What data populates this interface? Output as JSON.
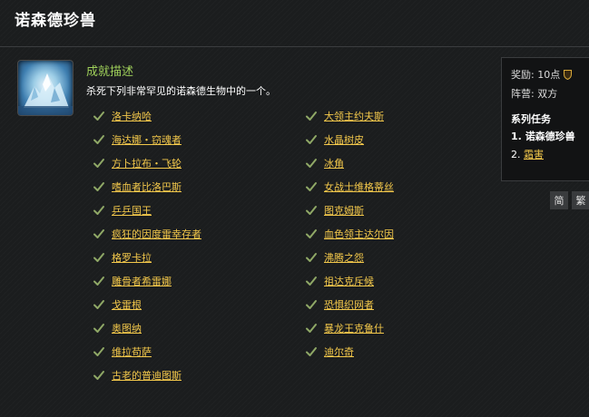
{
  "page": {
    "title": "诺森德珍兽"
  },
  "achievement": {
    "icon": "frozen-mountain-icon",
    "description_heading": "成就描述",
    "description": "杀死下列非常罕见的诺森德生物中的一个。"
  },
  "criteria": {
    "left": [
      "洛卡纳哈",
      "海达娜・窃魂者",
      "方卜拉布・飞轮",
      "嗜血者比洛巴斯",
      "乒乒国王",
      "疯狂的因度雷幸存者",
      "格罗卡拉",
      "雕骨者希雷娜",
      "戈雷根",
      "奥图纳",
      "维拉苟萨",
      "古老的普迪图斯"
    ],
    "right": [
      "大领主约夫斯",
      "水晶树皮",
      "冰角",
      "女战士维格蒂丝",
      "图克姆斯",
      "血色领主达尔因",
      "沸腾之怨",
      "祖达克斥候",
      "恐惧织网者",
      "暴龙王克鲁什",
      "迪尔奇"
    ],
    "check_icon": "checkmark-icon",
    "colors": {
      "link": "#f3c84b",
      "check": "#8fa866"
    }
  },
  "sidebar": {
    "reward_label": "奖励: 10点",
    "reward_icon": "shield-icon",
    "faction_label": "阵营: 双方",
    "series_heading": "系列任务",
    "series": [
      {
        "number": "1.",
        "label": "诺森德珍兽"
      },
      {
        "number": "2.",
        "label": "霜害"
      }
    ]
  },
  "lang_buttons": [
    "简",
    "繁"
  ],
  "colors": {
    "background": "#1b1d1e",
    "heading_green": "#9fd05a",
    "link_gold": "#f3c84b"
  }
}
